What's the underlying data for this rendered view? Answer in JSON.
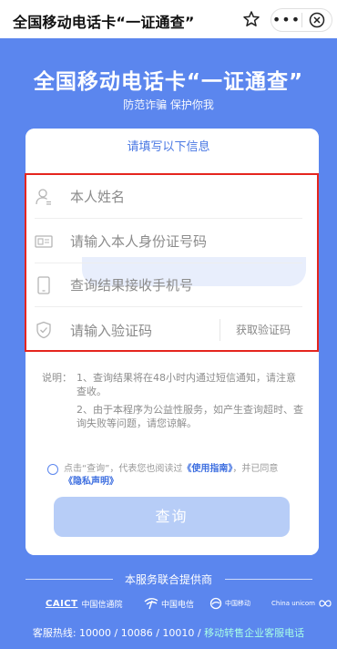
{
  "topbar": {
    "title": "全国移动电话卡“一证通查”",
    "more_label": "•••"
  },
  "hero": {
    "title": "全国移动电话卡“一证通查”",
    "subtitle": "防范诈骗 保护你我"
  },
  "form": {
    "header": "请填写以下信息",
    "name_placeholder": "本人姓名",
    "id_placeholder": "请输入本人身份证号码",
    "phone_placeholder": "查询结果接收手机号",
    "code_placeholder": "请输入验证码",
    "get_code_label": "获取验证码"
  },
  "notes": {
    "label": "说明：",
    "item1": "1、查询结果将在48小时内通过短信通知，请注意查收。",
    "item2": "2、由于本程序为公益性服务，如产生查询超时、查询失败等问题，请您谅解。"
  },
  "agreement": {
    "prefix": "点击“查询”，代表您也阅读过",
    "guide_link": "《使用指南》",
    "middle": "，并已同意",
    "privacy_link": "《隐私声明》"
  },
  "query_button": "查询",
  "footer": {
    "provider_text": "本服务联合提供商",
    "logos": {
      "caict_abbr": "CAICT",
      "caict_name": "中国信通院",
      "telecom": "中国电信",
      "mobile": "中国移动",
      "unicom": "China unicom"
    },
    "hotline_prefix": "客服热线: 10000 / 10086 / 10010 /",
    "hotline_link": "移动转售企业客服电话"
  },
  "colors": {
    "background": "#5b86ee",
    "accent": "#3e6fe0",
    "highlight_box": "#e5251e",
    "button": "#b7cdf7"
  }
}
